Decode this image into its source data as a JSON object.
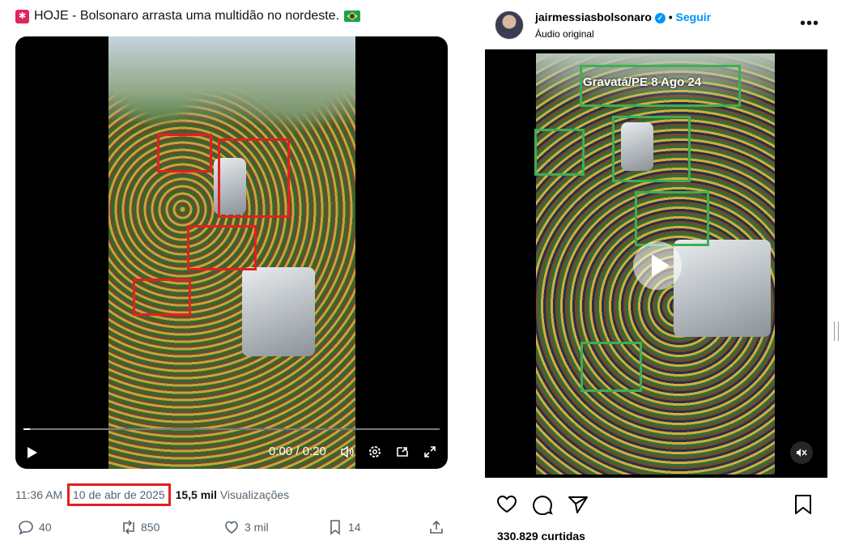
{
  "twitter": {
    "title": "HOJE - Bolsonaro arrasta uma multidão no nordeste.",
    "video_time": "0:00 / 0:20",
    "time": "11:36 AM",
    "date": "10 de abr de 2025",
    "views_count": "15,5 mil",
    "views_label": "Visualizações",
    "replies": "40",
    "reposts": "850",
    "likes": "3 mil",
    "bookmarks": "14"
  },
  "instagram": {
    "username": "jairmessiasbolsonaro",
    "follow_label": "Seguir",
    "separator": "•",
    "audio": "Áudio original",
    "caption": "Gravatá/PE 8 Ago 24",
    "likes": "330.829 curtidas"
  },
  "colors": {
    "highlight_red": "#e32020",
    "highlight_green": "#3fae52",
    "ig_blue": "#0095f6"
  }
}
